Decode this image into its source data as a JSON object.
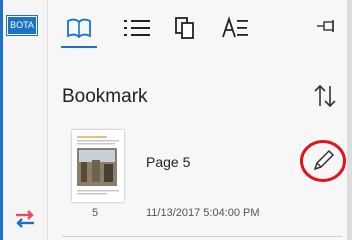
{
  "rail": {
    "bota_label": "BOTA"
  },
  "panel": {
    "title": "Bookmark",
    "tabs": [
      "bookmark-tab",
      "outline-tab",
      "thumbnails-tab",
      "annotations-tab"
    ]
  },
  "bookmarks": [
    {
      "label": "Page 5",
      "page_number": "5",
      "timestamp": "11/13/2017 5:04:00 PM"
    }
  ],
  "colors": {
    "accent": "#1a73c7",
    "highlight_circle": "#e0151b"
  },
  "icons": {
    "bota": "bota-icon",
    "swap": "swap-arrows-icon",
    "bookmark_tab": "open-book-icon",
    "outline_tab": "list-icon",
    "thumbnails_tab": "copy-pages-icon",
    "annotations_tab": "a-lines-icon",
    "pin": "pin-icon",
    "sort": "sort-arrows-icon",
    "edit": "pencil-icon"
  }
}
